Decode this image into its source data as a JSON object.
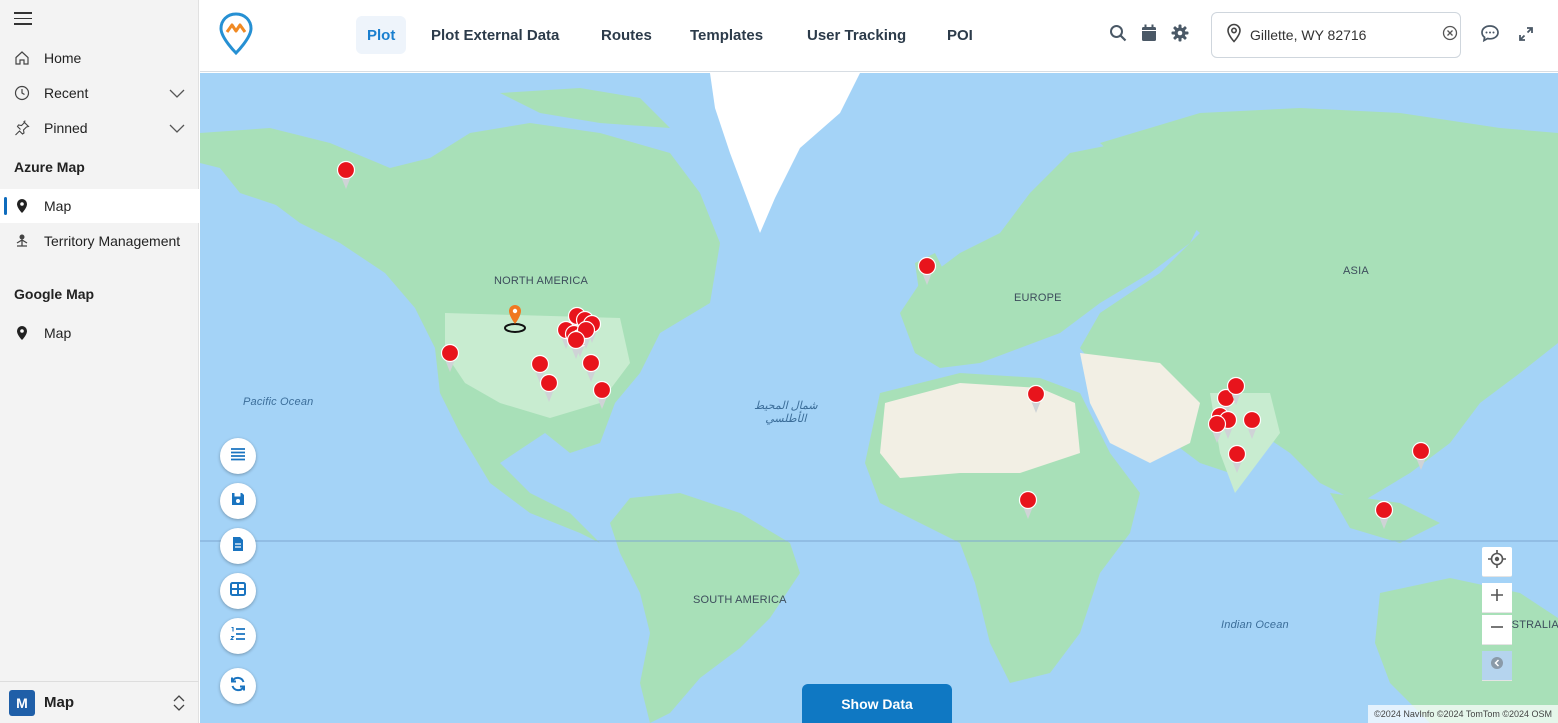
{
  "sidebar": {
    "items": [
      {
        "label": "Home",
        "icon": "home-icon"
      },
      {
        "label": "Recent",
        "icon": "clock-icon"
      },
      {
        "label": "Pinned",
        "icon": "pin-icon"
      }
    ],
    "groups": [
      {
        "title": "Azure Map",
        "items": [
          {
            "label": "Map",
            "icon": "map-pin-icon",
            "active": true
          },
          {
            "label": "Territory Management",
            "icon": "org-icon"
          }
        ]
      },
      {
        "title": "Google Map",
        "items": [
          {
            "label": "Map",
            "icon": "map-pin-icon"
          }
        ]
      }
    ],
    "app": {
      "badge": "M",
      "name": "Map"
    }
  },
  "header": {
    "tabs": [
      {
        "label": "Plot",
        "active": true
      },
      {
        "label": "Plot External Data"
      },
      {
        "label": "Routes"
      },
      {
        "label": "Templates"
      },
      {
        "label": "User Tracking"
      },
      {
        "label": "POI"
      }
    ],
    "location": {
      "value": "Gillette, WY 82716"
    }
  },
  "map": {
    "labels": {
      "north_america": "NORTH AMERICA",
      "south_america": "SOUTH AMERICA",
      "europe": "EUROPE",
      "asia": "ASIA",
      "australia": "AUSTRALIA",
      "pacific": "Pacific Ocean",
      "atlantic_line1": "شمال المحيط",
      "atlantic_line2": "الأطلسي",
      "indian": "Indian Ocean"
    },
    "show_data_label": "Show Data",
    "attribution": "©2024 NavInfo ©2024 TomTom ©2024 OSM",
    "colors": {
      "water": "#a4d3f7",
      "land": "#a8e0b8",
      "desert": "#f2efe4",
      "marker": "#e8141c",
      "accent": "#0f78c3"
    }
  }
}
